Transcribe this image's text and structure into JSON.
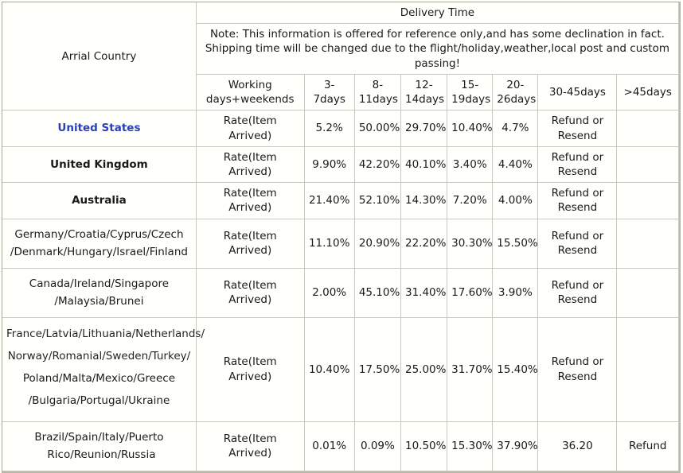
{
  "table": {
    "country_header": "Arrial Country",
    "delivery_header": "Delivery Time",
    "note": "Note: This information is offered for reference only,and has some declination in fact. Shipping time will be changed due to the flight/holiday,weather,local post and custom passing!",
    "note_color": "#3a33c9",
    "link_color": "#2a3fb8",
    "columns": [
      "Working days+weekends",
      "3-7days",
      "8-11days",
      "12-14days",
      "15-19days",
      "20-26days",
      "30-45days",
      ">45days"
    ],
    "columns_wrapped": [
      [
        "Working",
        "days+weekends"
      ],
      [
        "3-7days",
        ""
      ],
      [
        "8-",
        "11days"
      ],
      [
        "12-",
        "14days"
      ],
      [
        "15-",
        "19days"
      ],
      [
        "20-",
        "26days"
      ],
      [
        "30-45days",
        ""
      ],
      [
        ">45days",
        ""
      ]
    ],
    "rows": [
      {
        "country_lines": [
          "United States"
        ],
        "country_is_link": true,
        "rate_label": "Rate(Item Arrived)",
        "values": [
          "5.2%",
          "50.00%",
          "29.70%",
          "10.40%",
          "4.7%"
        ],
        "d3045": "Refund or Resend",
        "d45plus": ""
      },
      {
        "country_lines": [
          "United Kingdom"
        ],
        "country_is_link": false,
        "rate_label": "Rate(Item Arrived)",
        "values": [
          "9.90%",
          "42.20%",
          "40.10%",
          "3.40%",
          "4.40%"
        ],
        "d3045": "Refund or Resend",
        "d45plus": ""
      },
      {
        "country_lines": [
          "Australia"
        ],
        "country_is_link": false,
        "rate_label": "Rate(Item Arrived)",
        "values": [
          "21.40%",
          "52.10%",
          "14.30%",
          "7.20%",
          "4.00%"
        ],
        "d3045": "Refund or Resend",
        "d45plus": ""
      },
      {
        "country_lines": [
          "Germany/Croatia/Cyprus/Czech",
          "/Denmark/Hungary/Israel/Finland"
        ],
        "country_is_link": false,
        "rate_label": "Rate(Item Arrived)",
        "values": [
          "11.10%",
          "20.90%",
          "22.20%",
          "30.30%",
          "15.50%"
        ],
        "d3045": "Refund or Resend",
        "d45plus": ""
      },
      {
        "country_lines": [
          "Canada/Ireland/Singapore",
          "/Malaysia/Brunei"
        ],
        "country_is_link": false,
        "rate_label": "Rate(Item Arrived)",
        "values": [
          "2.00%",
          "45.10%",
          "31.40%",
          "17.60%",
          "3.90%"
        ],
        "d3045": "Refund or Resend",
        "d45plus": ""
      },
      {
        "country_lines": [
          "France/Latvia/Lithuania/Netherlands/",
          "Norway/Romanial/Sweden/Turkey/",
          "Poland/Malta/Mexico/Greece",
          "/Bulgaria/Portugal/Ukraine"
        ],
        "country_is_link": false,
        "rate_label": "Rate(Item Arrived)",
        "values": [
          "10.40%",
          "17.50%",
          "25.00%",
          "31.70%",
          "15.40%"
        ],
        "d3045": "Refund or Resend",
        "d45plus": ""
      },
      {
        "country_lines": [
          "Brazil/Spain/Italy/Puerto",
          "Rico/Reunion/Russia"
        ],
        "country_is_link": false,
        "rate_label": "Rate(Item Arrived)",
        "values": [
          "0.01%",
          "0.09%",
          "10.50%",
          "15.30%",
          "37.90%"
        ],
        "d3045": "36.20",
        "d45plus": "Refund"
      }
    ]
  }
}
